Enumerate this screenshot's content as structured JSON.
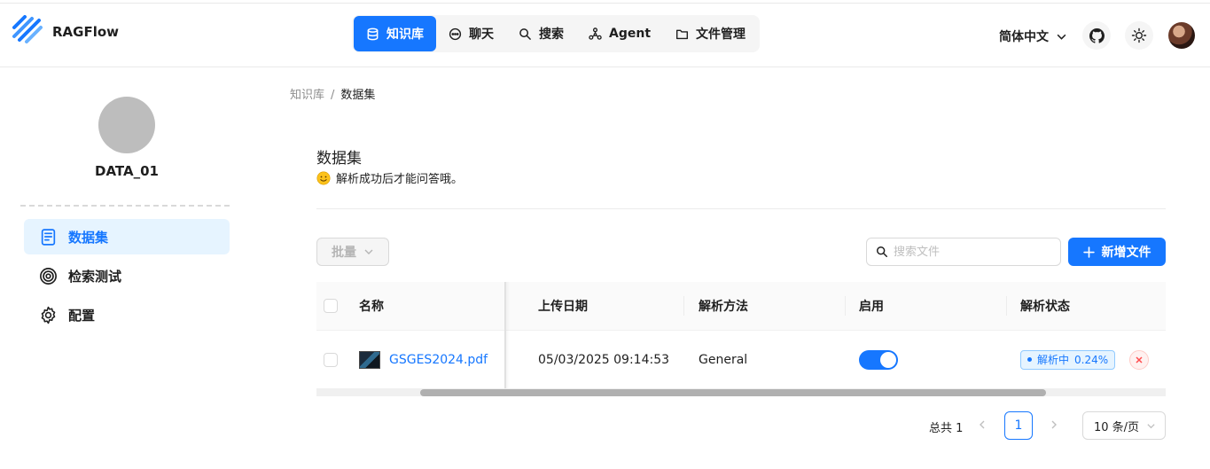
{
  "app": {
    "brand": "RAGFlow"
  },
  "nav": {
    "items": [
      {
        "label": "知识库",
        "icon": "database-icon",
        "active": true
      },
      {
        "label": "聊天",
        "icon": "chat-icon",
        "active": false
      },
      {
        "label": "搜索",
        "icon": "search-icon",
        "active": false
      },
      {
        "label": "Agent",
        "icon": "agent-graph-icon",
        "active": false
      },
      {
        "label": "文件管理",
        "icon": "folder-icon",
        "active": false
      }
    ]
  },
  "header": {
    "language": "简体中文"
  },
  "sidebar": {
    "kb_name": "DATA_01",
    "items": [
      {
        "label": "数据集",
        "icon": "document-icon",
        "active": true
      },
      {
        "label": "检索测试",
        "icon": "target-icon",
        "active": false
      },
      {
        "label": "配置",
        "icon": "gear-icon",
        "active": false
      }
    ]
  },
  "breadcrumb": {
    "parent": "知识库",
    "separator": "/",
    "current": "数据集"
  },
  "page": {
    "title": "数据集",
    "subtitle": "解析成功后才能问答哦。"
  },
  "toolbar": {
    "batch_label": "批量",
    "search_placeholder": "搜索文件",
    "add_label": "新增文件"
  },
  "table": {
    "columns": [
      "名称",
      "上传日期",
      "解析方法",
      "启用",
      "解析状态"
    ],
    "rows": [
      {
        "name": "GSGES2024.pdf",
        "upload_date": "05/03/2025 09:14:53",
        "parse_method": "General",
        "enabled": true,
        "status": "解析中",
        "progress": "0.24%"
      }
    ]
  },
  "pagination": {
    "total_label": "总共 1",
    "current_page": "1",
    "page_size": "10 条/页"
  },
  "colors": {
    "primary": "#1677ff",
    "danger": "#ff4d4f",
    "accent_bg": "#e6f4ff"
  }
}
